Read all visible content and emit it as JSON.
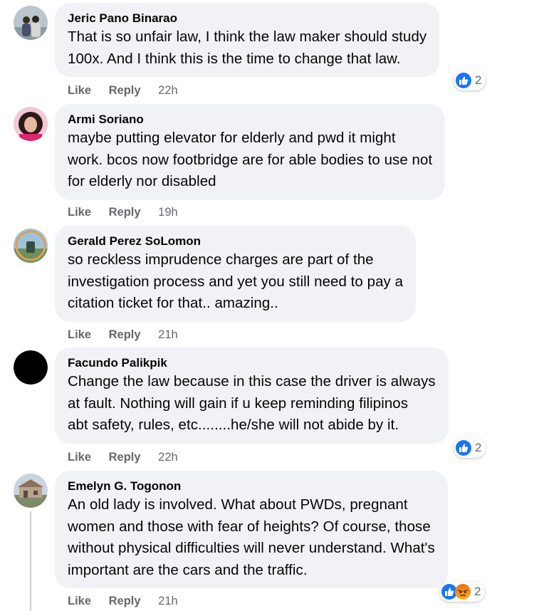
{
  "comments": [
    {
      "author": "Jeric Pano Binarao",
      "lines": [
        "That is so unfair law, I think the law maker should study",
        "100x. And I think this is the time to change that law."
      ],
      "like": "Like",
      "reply": "Reply",
      "time": "22h",
      "reactions": {
        "count": "2",
        "types": [
          "like"
        ]
      }
    },
    {
      "author": "Armi Soriano",
      "lines": [
        "maybe putting elevator for elderly and pwd it might",
        "work. bcos now footbridge are for able bodies to use not",
        "for elderly nor disabled"
      ],
      "like": "Like",
      "reply": "Reply",
      "time": "19h"
    },
    {
      "author": "Gerald Perez SoLomon",
      "lines": [
        "so reckless imprudence charges are part of the",
        "investigation process and yet you still need to pay a",
        "citation ticket for that.. amazing.."
      ],
      "like": "Like",
      "reply": "Reply",
      "time": "21h"
    },
    {
      "author": "Facundo Palikpik",
      "lines": [
        "Change the law because in this case the driver is always",
        "at fault. Nothing will gain if u keep reminding filipinos",
        "abt safety, rules, etc........he/she will not abide by it."
      ],
      "like": "Like",
      "reply": "Reply",
      "time": "22h",
      "reactions": {
        "count": "2",
        "types": [
          "like"
        ]
      }
    },
    {
      "author": "Emelyn G. Togonon",
      "lines": [
        "An old lady is involved. What about PWDs, pregnant",
        "women and those with fear of heights? Of course, those",
        "without physical difficulties will never understand. What's",
        "important are the cars and the traffic."
      ],
      "like": "Like",
      "reply": "Reply",
      "time": "21h",
      "reactions": {
        "count": "2",
        "types": [
          "like",
          "angry"
        ]
      }
    }
  ],
  "colors": {
    "bubble": "#f0f2f5",
    "meta_text": "#65676b",
    "like_blue": "#1877f2",
    "angry_orange": "#e9710f"
  }
}
